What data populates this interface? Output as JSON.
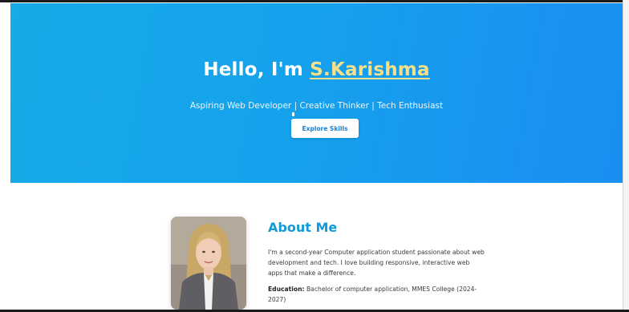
{
  "hero": {
    "greeting": "Hello, I'm ",
    "name": "S.Karishma",
    "tagline": "Aspiring Web Developer | Creative Thinker | Tech Enthusiast",
    "button_label": "Explore Skills"
  },
  "about": {
    "title": "About Me",
    "bio": "I'm a second-year Computer application student passionate about web development and tech. I love building responsive, interactive web apps that make a difference.",
    "education_label": "Education:",
    "education_value": " Bachelor of computer application, MMES College (2024-2027)",
    "photo_icon": "profile-photo"
  },
  "colors": {
    "hero_gradient_start": "#17a9e8",
    "hero_gradient_end": "#1a8ef2",
    "name_highlight": "#f7e08a",
    "about_title": "#129bd8",
    "button_text": "#1a7fd6"
  }
}
